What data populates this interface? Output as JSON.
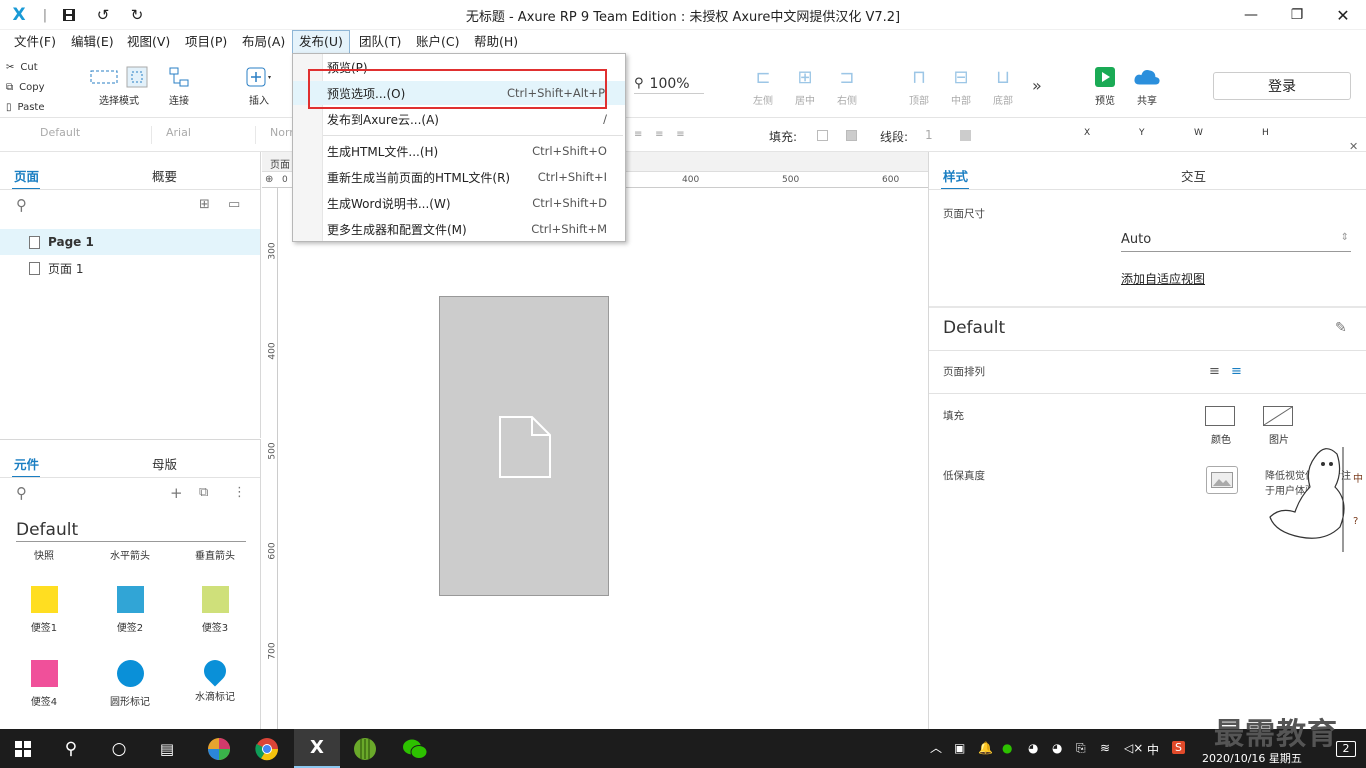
{
  "window": {
    "title": "无标题 - Axure RP 9 Team Edition : 未授权    Axure中文网提供汉化 V7.2]"
  },
  "menubar": {
    "items": [
      "文件(F)",
      "编辑(E)",
      "视图(V)",
      "项目(P)",
      "布局(A)",
      "发布(U)",
      "团队(T)",
      "账户(C)",
      "帮助(H)"
    ],
    "active": "发布(U)"
  },
  "toolbar": {
    "cut": "Cut",
    "copy": "Copy",
    "paste": "Paste",
    "select_mode": "选择模式",
    "connect": "连接",
    "insert": "插入",
    "zoom": "100%",
    "align": [
      "左侧",
      "居中",
      "右侧",
      "顶部",
      "中部",
      "底部"
    ],
    "preview": "预览",
    "share": "共享",
    "login": "登录",
    "colors": {
      "preview": "#1aaa55",
      "share": "#2b8fdc"
    }
  },
  "formatbar": {
    "style": "Default",
    "font": "Arial",
    "font_style": "Norr",
    "fill_label": "填充:",
    "line_label": "线段:",
    "line_value": "1",
    "x_label": "X",
    "y_label": "Y",
    "w_label": "W",
    "h_label": "H"
  },
  "pages_panel": {
    "tabs": [
      "页面",
      "概要"
    ],
    "pages": [
      "Page 1",
      "页面 1"
    ],
    "selected": "Page 1"
  },
  "library_panel": {
    "tabs": [
      "元件",
      "母版"
    ],
    "library": "Default",
    "row_labels": [
      "快照",
      "水平箭头",
      "垂直箭头"
    ],
    "items": [
      {
        "label": "便签1",
        "color": "#ffde21"
      },
      {
        "label": "便签2",
        "color": "#31a5d6"
      },
      {
        "label": "便签3",
        "color": "#cfe07a"
      },
      {
        "label": "便签4",
        "color": "#f0509a"
      },
      {
        "label": "圆形标记",
        "color": "#0a90d8"
      },
      {
        "label": "水滴标记",
        "color": "#0a90d8"
      }
    ]
  },
  "canvas": {
    "page_tab": "页面",
    "ruler_top": [
      "0",
      "400",
      "500",
      "600"
    ],
    "ruler_left": [
      "300",
      "400",
      "500",
      "600",
      "700"
    ]
  },
  "publish_menu": {
    "items": [
      {
        "label": "预览(P)",
        "shortcut": ""
      },
      {
        "label": "预览选项...(O)",
        "shortcut": "Ctrl+Shift+Alt+P"
      },
      {
        "label": "发布到Axure云...(A)",
        "shortcut": "/"
      },
      {
        "label": "生成HTML文件...(H)",
        "shortcut": "Ctrl+Shift+O"
      },
      {
        "label": "重新生成当前页面的HTML文件(R)",
        "shortcut": "Ctrl+Shift+I"
      },
      {
        "label": "生成Word说明书...(W)",
        "shortcut": "Ctrl+Shift+D"
      },
      {
        "label": "更多生成器和配置文件(M)",
        "shortcut": "Ctrl+Shift+M"
      }
    ],
    "highlighted": "预览选项...(O)"
  },
  "right_panel": {
    "tabs": [
      "样式",
      "交互"
    ],
    "page_size_label": "页面尺寸",
    "page_size_value": "Auto",
    "add_adaptive": "添加自适应视图",
    "style_name": "Default",
    "page_align_label": "页面排列",
    "fill_label": "填充",
    "fill_color": "颜色",
    "fill_image": "图片",
    "low_fidelity_label": "低保真度",
    "low_fidelity_desc_1": "降低视觉保",
    "low_fidelity_desc_1b": "专注",
    "low_fidelity_desc_2": "于用户体验"
  },
  "taskbar": {
    "ime": "中",
    "date": "2020/10/16 星期五",
    "badge": "2",
    "watermark": "最需教育"
  }
}
